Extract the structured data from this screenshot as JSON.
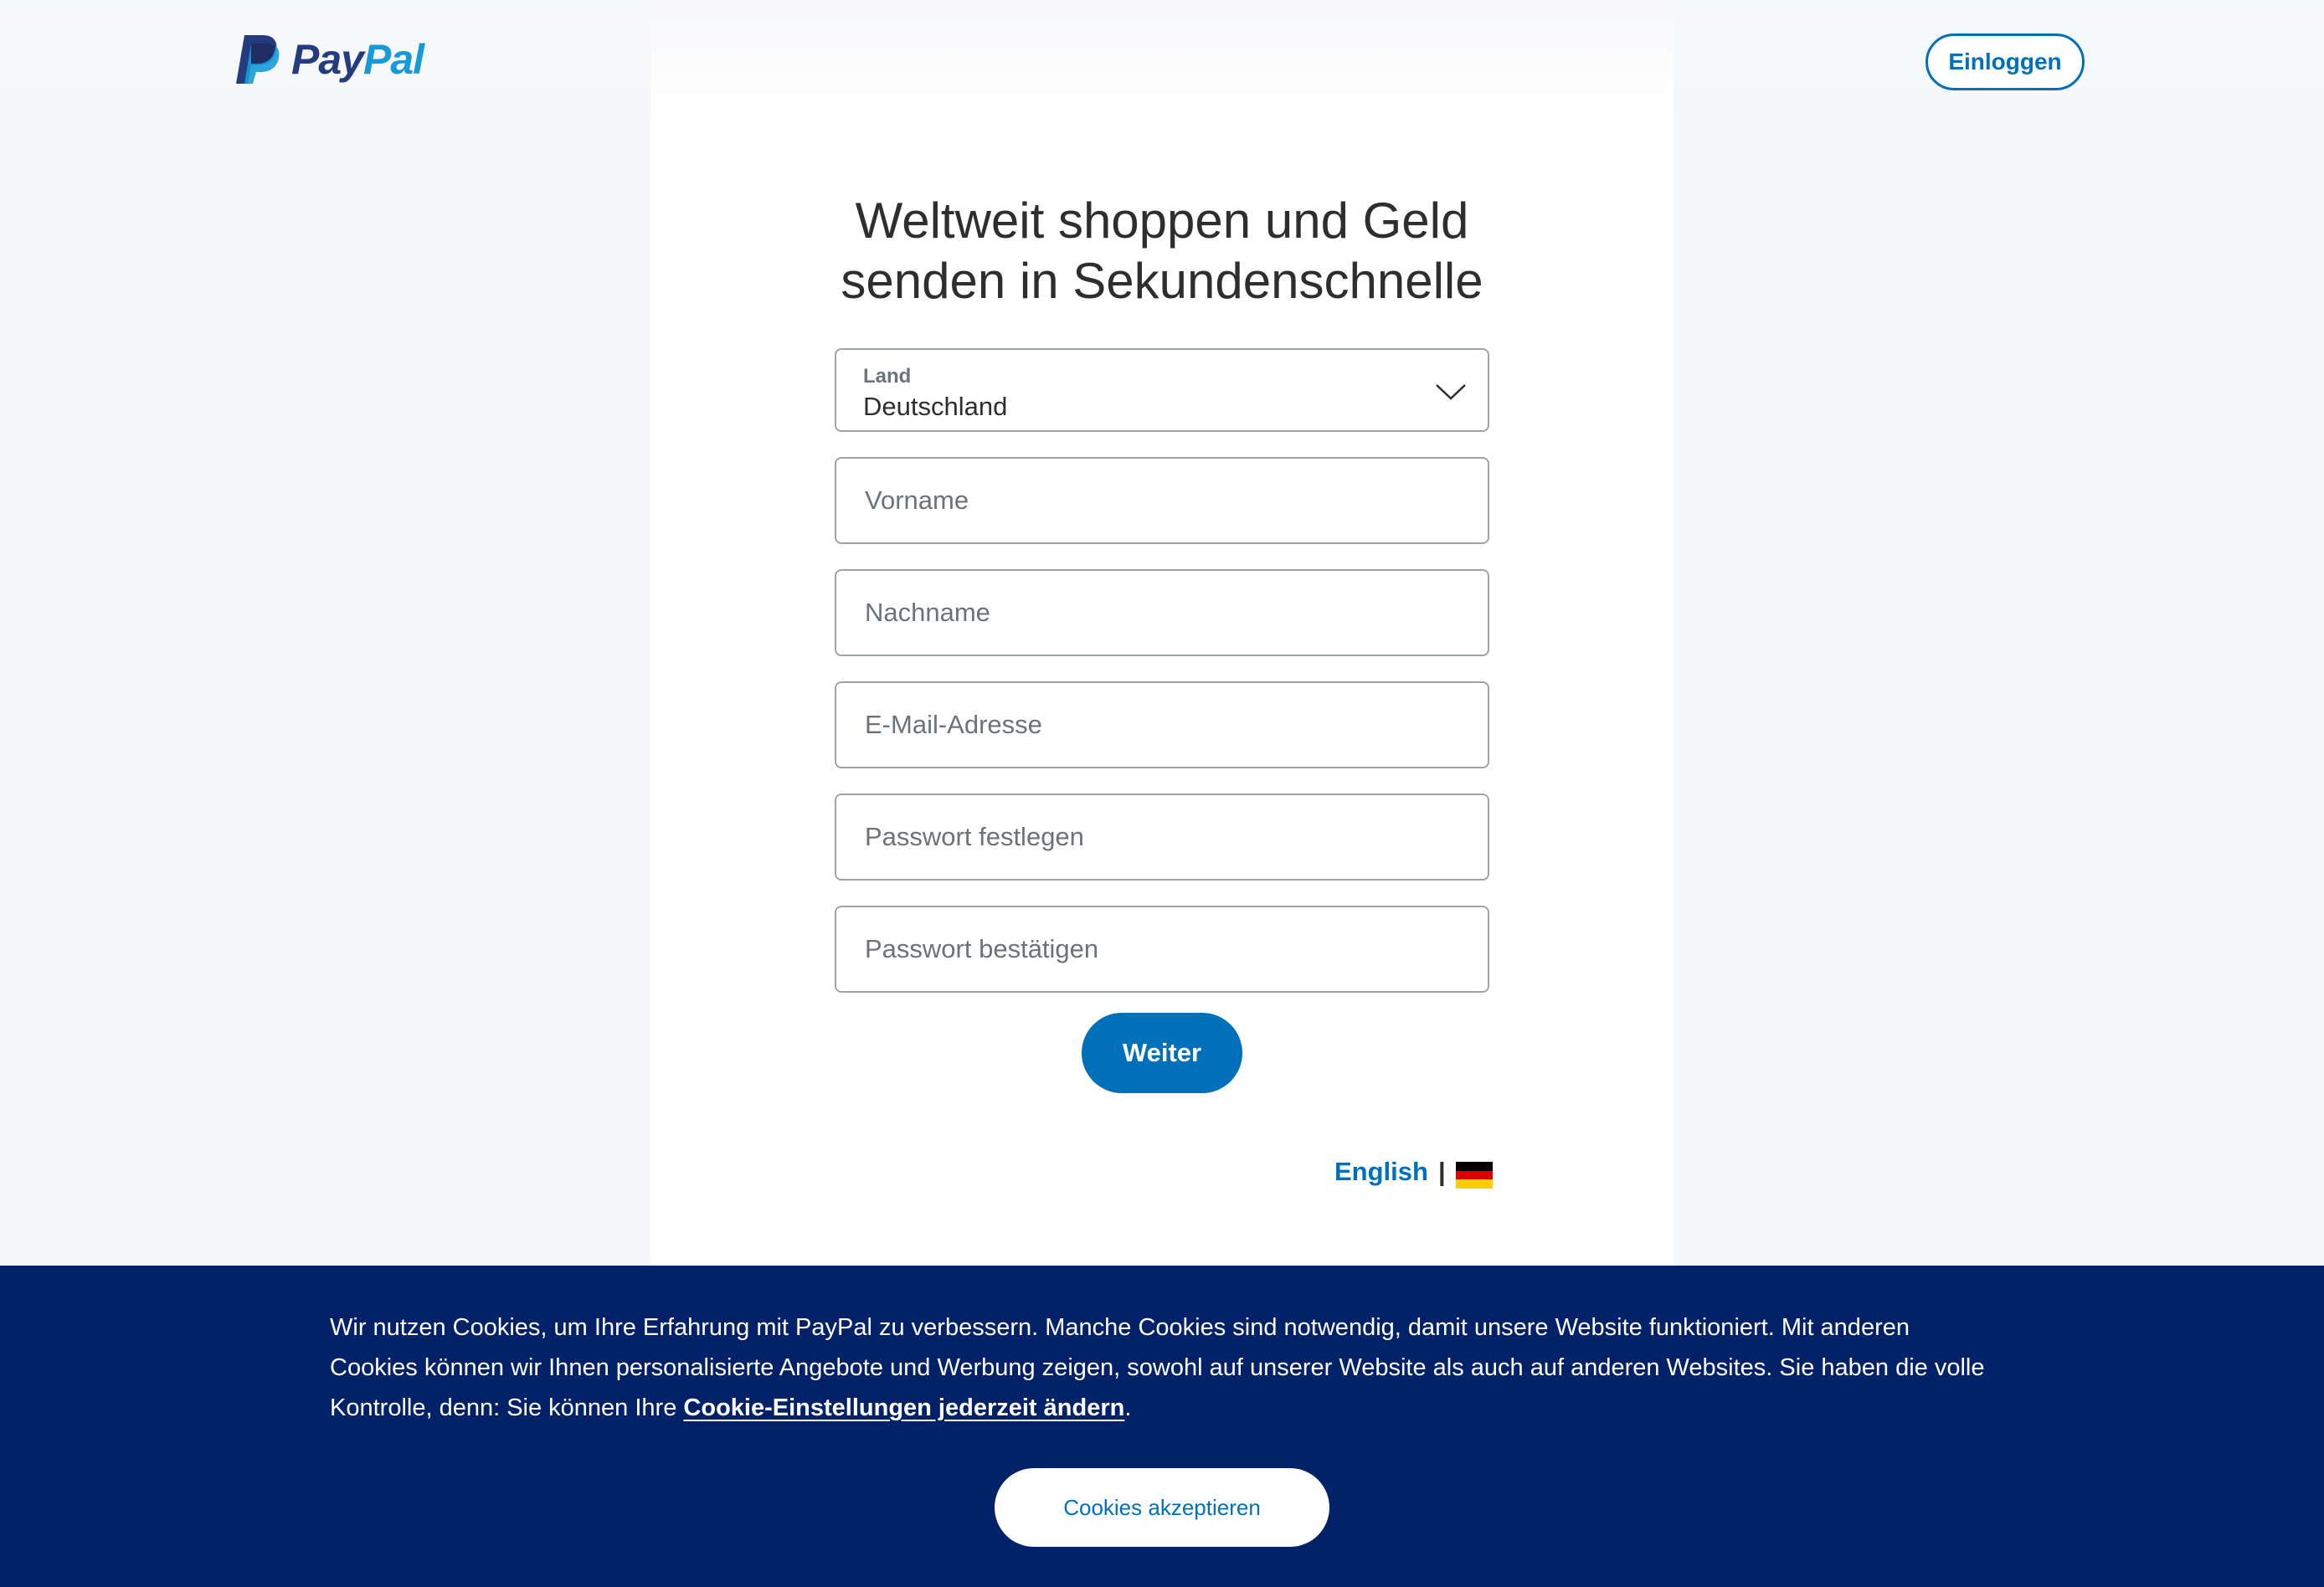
{
  "header": {
    "logo_pay": "Pay",
    "logo_pal": "Pal",
    "login_label": "Einloggen"
  },
  "main": {
    "heading_line1": "Weltweit shoppen und Geld",
    "heading_line2": "senden in Sekundenschnelle",
    "country": {
      "label": "Land",
      "value": "Deutschland"
    },
    "fields": {
      "first_name_placeholder": "Vorname",
      "last_name_placeholder": "Nachname",
      "email_placeholder": "E-Mail-Adresse",
      "password_placeholder": "Passwort festlegen",
      "confirm_password_placeholder": "Passwort bestätigen"
    },
    "continue_label": "Weiter",
    "language": {
      "link": "English",
      "separator": "|",
      "flag_icon": "germany-flag-icon",
      "flag_colors": [
        "#000000",
        "#dd0000",
        "#ffce00"
      ]
    }
  },
  "cookie_banner": {
    "text_before_link": "Wir nutzen Cookies, um Ihre Erfahrung mit PayPal zu verbessern. Manche Cookies sind notwendig, damit unsere Website funktioniert. Mit anderen Cookies können wir Ihnen personalisierte Angebote und Werbung zeigen, sowohl auf unserer Website als auch auf anderen Websites. Sie haben die volle Kontrolle, denn: Sie können Ihre ",
    "link_text": "Cookie-Einstellungen jederzeit ändern",
    "text_after_link": ".",
    "accept_label": "Cookies akzeptieren"
  },
  "colors": {
    "brand_blue": "#0070ba",
    "brand_dark": "#253b80",
    "brand_light": "#179bd7",
    "banner_navy": "#012169",
    "page_bg": "#f5f7fa"
  }
}
